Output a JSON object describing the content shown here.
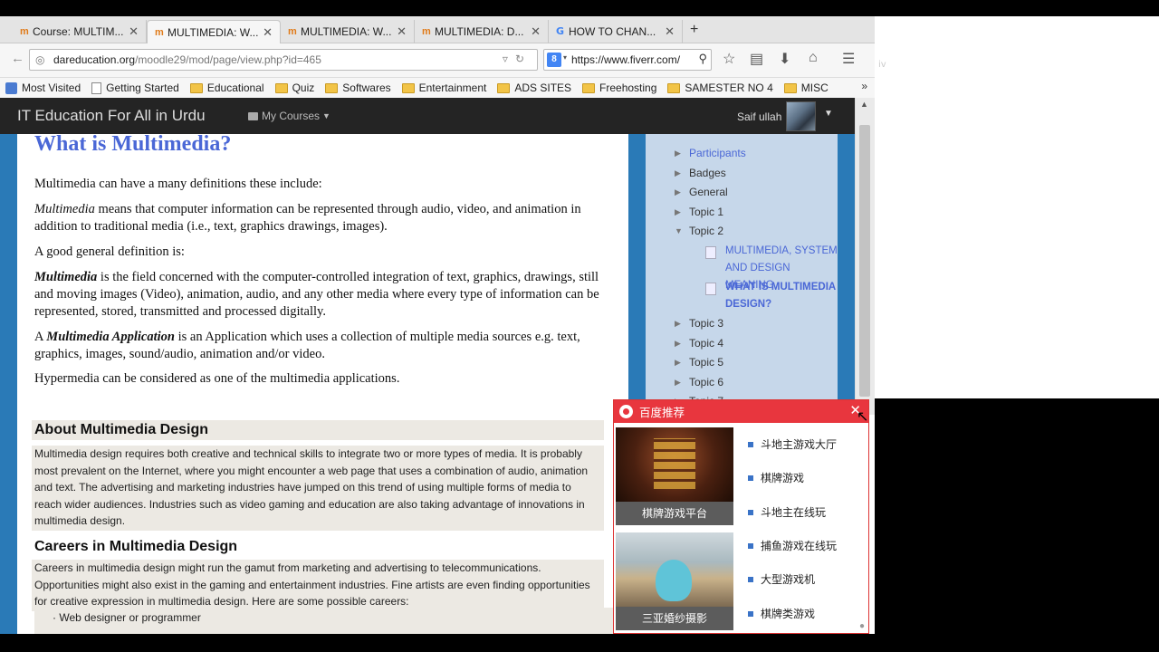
{
  "tabs": [
    {
      "label": "Course: MULTIM...",
      "icon": "moodle-icon"
    },
    {
      "label": "MULTIMEDIA: W...",
      "icon": "moodle-icon",
      "active": true
    },
    {
      "label": "MULTIMEDIA: W...",
      "icon": "moodle-icon"
    },
    {
      "label": "MULTIMEDIA: D...",
      "icon": "moodle-icon"
    },
    {
      "label": "HOW TO CHAN...",
      "icon": "google-icon"
    }
  ],
  "url": {
    "domain": "dareducation.org",
    "path": "/moodle29/mod/page/view.php?id=465"
  },
  "search": {
    "value": "https://www.fiverr.com/",
    "engine_letter": "8"
  },
  "bookmarks": [
    "Most Visited",
    "Getting Started",
    "Educational",
    "Quiz",
    "Softwares",
    "Entertainment",
    "ADS SITES",
    "Freehosting",
    "SAMESTER NO 4",
    "MISC"
  ],
  "site": {
    "brand": "IT Education For All in Urdu",
    "my_courses": "My Courses",
    "user_name": "Saif ullah"
  },
  "content": {
    "title": "What is Multimedia?",
    "p1": "Multimedia can have a many definitions these include:",
    "p2_em": "Multimedia",
    "p2_rest": " means that computer information can be represented through audio, video, and animation in addition to traditional media (i.e., text, graphics drawings, images).",
    "p3": "A good general definition is:",
    "p4_em": "Multimedia",
    "p4_rest": " is the field concerned with the computer-controlled integration of text, graphics, drawings, still and moving images (Video), animation, audio, and any other media where every type of information can be represented, stored, transmitted and processed digitally.",
    "p5_pre": "A ",
    "p5_em": "Multimedia Application",
    "p5_rest": " is an Application which uses a collection of multiple media sources e.g. text, graphics, images, sound/audio, animation and/or video.",
    "p6": "Hypermedia can be considered as one of the multimedia applications.",
    "h_about": "About Multimedia Design",
    "about_text": "Multimedia design requires both creative and technical skills to integrate two or more types of media. It is probably most prevalent on the Internet, where you might encounter a web page that uses a combination of audio, animation and text. The advertising and marketing industries have jumped on this trend of using multiple forms of media to reach wider audiences. Industries such as video gaming and education are also taking advantage of innovations in multimedia design.",
    "h_careers": "Careers in Multimedia Design",
    "careers_text": "Careers in multimedia design might run the gamut from marketing and advertising to telecommunications. Opportunities might also exist in the gaming and entertainment industries. Fine artists are even finding opportunities for creative expression in multimedia design. Here are some possible careers:",
    "career_item": "Web designer or programmer"
  },
  "sidebar": {
    "participants": "Participants",
    "badges": "Badges",
    "general": "General",
    "topic1": "Topic 1",
    "topic2": "Topic 2",
    "sub1": "MULTIMEDIA, SYSTEM AND DESIGN MEANING",
    "sub2": "WHAT IS MULTIMEDIA DESIGN?",
    "topic3": "Topic 3",
    "topic4": "Topic 4",
    "topic5": "Topic 5",
    "topic6": "Topic 6",
    "topic7": "Topic 7"
  },
  "popup": {
    "title": "百度推荐",
    "img1_caption": "棋牌游戏平台",
    "img2_caption": "三亚婚纱摄影",
    "links": [
      "斗地主游戏大厅",
      "棋牌游戏",
      "斗地主在线玩",
      "捕鱼游戏在线玩",
      "大型游戏机",
      "棋牌类游戏"
    ]
  },
  "colors": {
    "accent": "#4a67d6",
    "popup_red": "#e8363e",
    "site_blue": "#2a7ab7"
  }
}
